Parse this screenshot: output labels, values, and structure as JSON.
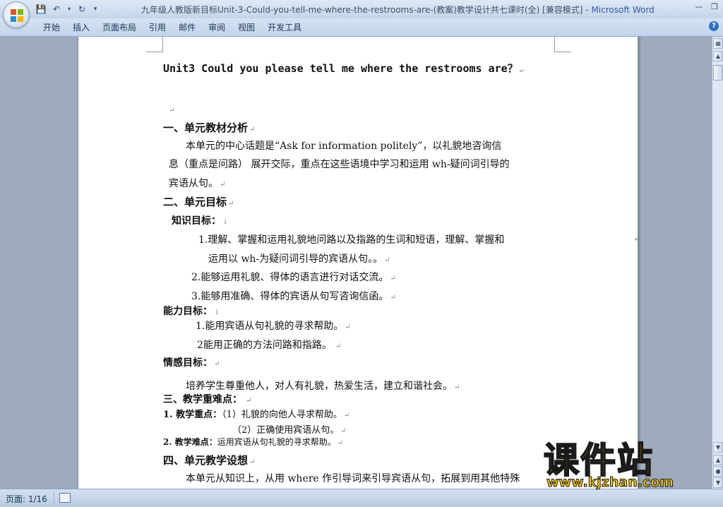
{
  "window": {
    "title": "九年级人教版新目标Unit-3-Could-you-tell-me-where-the-restrooms-are-(教案)教学设计共七课时(全) [兼容模式] - ",
    "app_name": "Microsoft Word"
  },
  "ribbon": {
    "tabs": [
      "开始",
      "插入",
      "页面布局",
      "引用",
      "邮件",
      "审阅",
      "视图",
      "开发工具"
    ]
  },
  "document": {
    "title": "Unit3 Could you please tell me where the restrooms are？",
    "s1_heading": "一、单元教材分析",
    "s1_p1": "本单元的中心话题是“Ask for information politely”，以礼貌地咨询信",
    "s1_p2": "息（重点是问路） 展开交际，重点在这些语境中学习和运用 wh-疑问词引导的",
    "s1_p3": "宾语从句。",
    "s2_heading": "二、单元目标",
    "knowledge_label": "知识目标：",
    "k1_a": "1.理解、掌握和运用礼貌地问路以及指路的生词和短语，理解、掌握和",
    "k1_b": "运用以 wh-为疑问词引导的宾语从句。。",
    "k2": "2.能够运用礼貌、得体的语言进行对话交流。",
    "k3": "3.能够用准确、得体的宾语从句写咨询信函。",
    "ability_label": "能力目标：",
    "a1": "1.能用宾语从句礼貌的寻求帮助。",
    "a2": "2能用正确的方法问路和指路。",
    "emotion_label": "情感目标：",
    "e1": "培养学生尊重他人，对人有礼貌，热爱生活，建立和谐社会。",
    "s3_heading": "三、教学重难点：",
    "key_label": "1. 教学重点：",
    "key_1": "（1）礼貌的向他人寻求帮助。",
    "key_2": "（2）正确使用宾语从句。",
    "diff_label": "2. 教学难点：",
    "diff_text": "运用宾语从句礼貌的寻求帮助。",
    "s4_heading": "四、单元教学设想",
    "s4_p1": "本单元从知识上，从用 where 作引导词来引导宾语从句，拓展到用其他特殊"
  },
  "status": {
    "page": "页面: 1/16"
  },
  "watermark": {
    "main": "课件站",
    "url": "www.kjzhan.com"
  }
}
